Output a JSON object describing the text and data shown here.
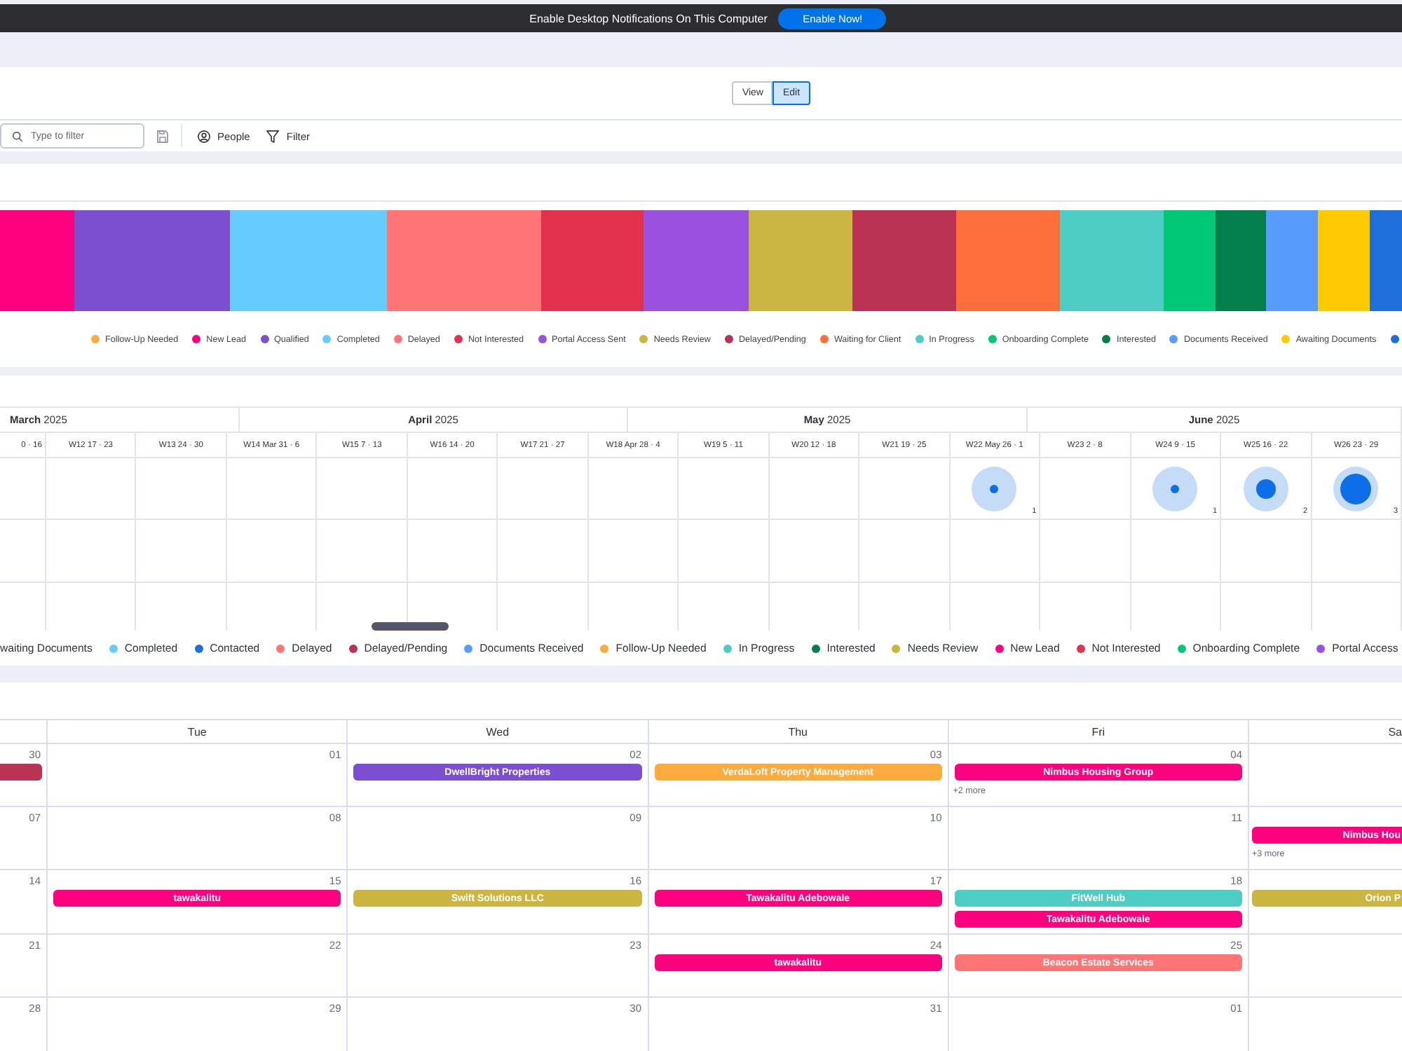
{
  "notification_bar": {
    "message": "Enable Desktop Notifications On This Computer",
    "button": "Enable Now!"
  },
  "view_toggle": [
    {
      "label": "View",
      "selected": false
    },
    {
      "label": "Edit",
      "selected": true
    }
  ],
  "toolbar": {
    "search": {
      "placeholder": "Type to filter"
    },
    "people": "People",
    "filter": "Filter"
  },
  "status_blocks": [
    {
      "color": "#ff007f"
    },
    {
      "color": "#7b4fcf"
    },
    {
      "color": "#66ccff"
    },
    {
      "color": "#ff7575"
    },
    {
      "color": "#e2324d"
    },
    {
      "color": "#9b51e0"
    },
    {
      "color": "#cab641"
    },
    {
      "color": "#bb3354"
    },
    {
      "color": "#ff6d3b"
    },
    {
      "color": "#4ecdc4"
    },
    {
      "color": "#00c875"
    },
    {
      "color": "#037f4c"
    },
    {
      "color": "#579bfc"
    },
    {
      "color": "#ffcb00"
    },
    {
      "color": "#1f6fdb"
    }
  ],
  "status_legend": [
    {
      "label": "Follow-Up Needed",
      "color": "#fdab3d"
    },
    {
      "label": "New Lead",
      "color": "#ff007f"
    },
    {
      "label": "Qualified",
      "color": "#7b4fcf"
    },
    {
      "label": "Completed",
      "color": "#66ccff"
    },
    {
      "label": "Delayed",
      "color": "#ff7575"
    },
    {
      "label": "Not Interested",
      "color": "#e2324d"
    },
    {
      "label": "Portal Access Sent",
      "color": "#9b51e0"
    },
    {
      "label": "Needs Review",
      "color": "#cab641"
    },
    {
      "label": "Delayed/Pending",
      "color": "#bb3354"
    },
    {
      "label": "Waiting for Client",
      "color": "#ff6d3b"
    },
    {
      "label": "In Progress",
      "color": "#4ecdc4"
    },
    {
      "label": "Onboarding Complete",
      "color": "#00c875"
    },
    {
      "label": "Interested",
      "color": "#037f4c"
    },
    {
      "label": "Documents Received",
      "color": "#579bfc"
    },
    {
      "label": "Awaiting Documents",
      "color": "#ffcb00"
    },
    {
      "color": "#1f6fdb"
    }
  ],
  "timeline": {
    "months": [
      "**March** 2025",
      "**April** 2025",
      "**May** 2025",
      "**June** 2025"
    ],
    "weeks": [
      {
        "label": "0 · 16"
      },
      {
        "label": "W12 17 · 23"
      },
      {
        "label": "W13 24 · 30"
      },
      {
        "label": "W14 Mar 31 · 6"
      },
      {
        "label": "W15 7 · 13"
      },
      {
        "label": "W16 14 · 20"
      },
      {
        "label": "W17 21 · 27"
      },
      {
        "label": "W18 Apr 28 · 4"
      },
      {
        "label": "W19 5 · 11"
      },
      {
        "label": "W20 12 · 18"
      },
      {
        "label": "W21 19 · 25"
      },
      {
        "label": "W22 May 26 · 1",
        "count": "1"
      },
      {
        "label": "W23 2 · 8"
      },
      {
        "label": "W24 9 · 15",
        "count": "1"
      },
      {
        "label": "W25 16 · 22",
        "count": "2"
      },
      {
        "label": "W26 23 · 29",
        "count": "3"
      }
    ]
  },
  "timeline_legend": [
    {
      "label": "waiting Documents"
    },
    {
      "label": "Completed",
      "color": "#66ccff"
    },
    {
      "label": "Contacted",
      "color": "#1f6fdb"
    },
    {
      "label": "Delayed",
      "color": "#ff7575"
    },
    {
      "label": "Delayed/Pending",
      "color": "#bb3354"
    },
    {
      "label": "Documents Received",
      "color": "#579bfc"
    },
    {
      "label": "Follow-Up Needed",
      "color": "#fdab3d"
    },
    {
      "label": "In Progress",
      "color": "#4ecdc4"
    },
    {
      "label": "Interested",
      "color": "#037f4c"
    },
    {
      "label": "Needs Review",
      "color": "#cab641"
    },
    {
      "label": "New Lead",
      "color": "#ff007f"
    },
    {
      "label": "Not Interested",
      "color": "#e2324d"
    },
    {
      "label": "Onboarding Complete",
      "color": "#00c875"
    },
    {
      "label": "Portal Access",
      "color": "#9b51e0"
    }
  ],
  "calendar": {
    "day_headers": [
      "Tue",
      "Wed",
      "Thu",
      "Fri",
      "Sa"
    ],
    "weeks": [
      {
        "days": [
          {
            "date": "30",
            "events": [
              {
                "color": "#bb3354"
              }
            ]
          },
          {
            "date": "01"
          },
          {
            "date": "02",
            "events": [
              {
                "title": "DwellBright Properties",
                "color": "#7b4fcf"
              }
            ]
          },
          {
            "date": "03",
            "events": [
              {
                "title": "VerdaLoft Property Management",
                "color": "#fdab3d"
              }
            ]
          },
          {
            "date": "04",
            "events": [
              {
                "title": "Nimbus Housing Group",
                "color": "#ff007f"
              }
            ],
            "more": "+2 more"
          }
        ]
      },
      {
        "days": [
          {
            "date": "07"
          },
          {
            "date": "08"
          },
          {
            "date": "09"
          },
          {
            "date": "10"
          },
          {
            "date": "11"
          },
          {
            "events": [
              {
                "title": "Nimbus Hou",
                "color": "#ff007f"
              }
            ],
            "more": "+3 more"
          }
        ]
      },
      {
        "days": [
          {
            "date": "14"
          },
          {
            "date": "15",
            "events": [
              {
                "title": "tawakalitu",
                "color": "#ff007f"
              }
            ]
          },
          {
            "date": "16",
            "events": [
              {
                "title": "Swift Solutions LLC",
                "color": "#cab641"
              }
            ]
          },
          {
            "date": "17",
            "events": [
              {
                "title": "Tawakalitu Adebowale",
                "color": "#ff007f"
              }
            ]
          },
          {
            "date": "18",
            "events": [
              {
                "title": "FitWell Hub",
                "color": "#4ecdc4"
              },
              {
                "title": "Tawakalitu Adebowale",
                "color": "#ff007f"
              }
            ]
          },
          {
            "events": [
              {
                "title": "Orion P",
                "color": "#cab641"
              }
            ]
          }
        ]
      },
      {
        "days": [
          {
            "date": "21"
          },
          {
            "date": "22"
          },
          {
            "date": "23"
          },
          {
            "date": "24",
            "events": [
              {
                "title": "tawakalitu",
                "color": "#ff007f"
              }
            ]
          },
          {
            "date": "25",
            "events": [
              {
                "title": "Beacon Estate Services",
                "color": "#ff7575"
              }
            ]
          }
        ]
      },
      {
        "days": [
          {
            "date": "28"
          },
          {
            "date": "29"
          },
          {
            "date": "30"
          },
          {
            "date": "31"
          },
          {
            "date": "01"
          }
        ]
      }
    ]
  }
}
